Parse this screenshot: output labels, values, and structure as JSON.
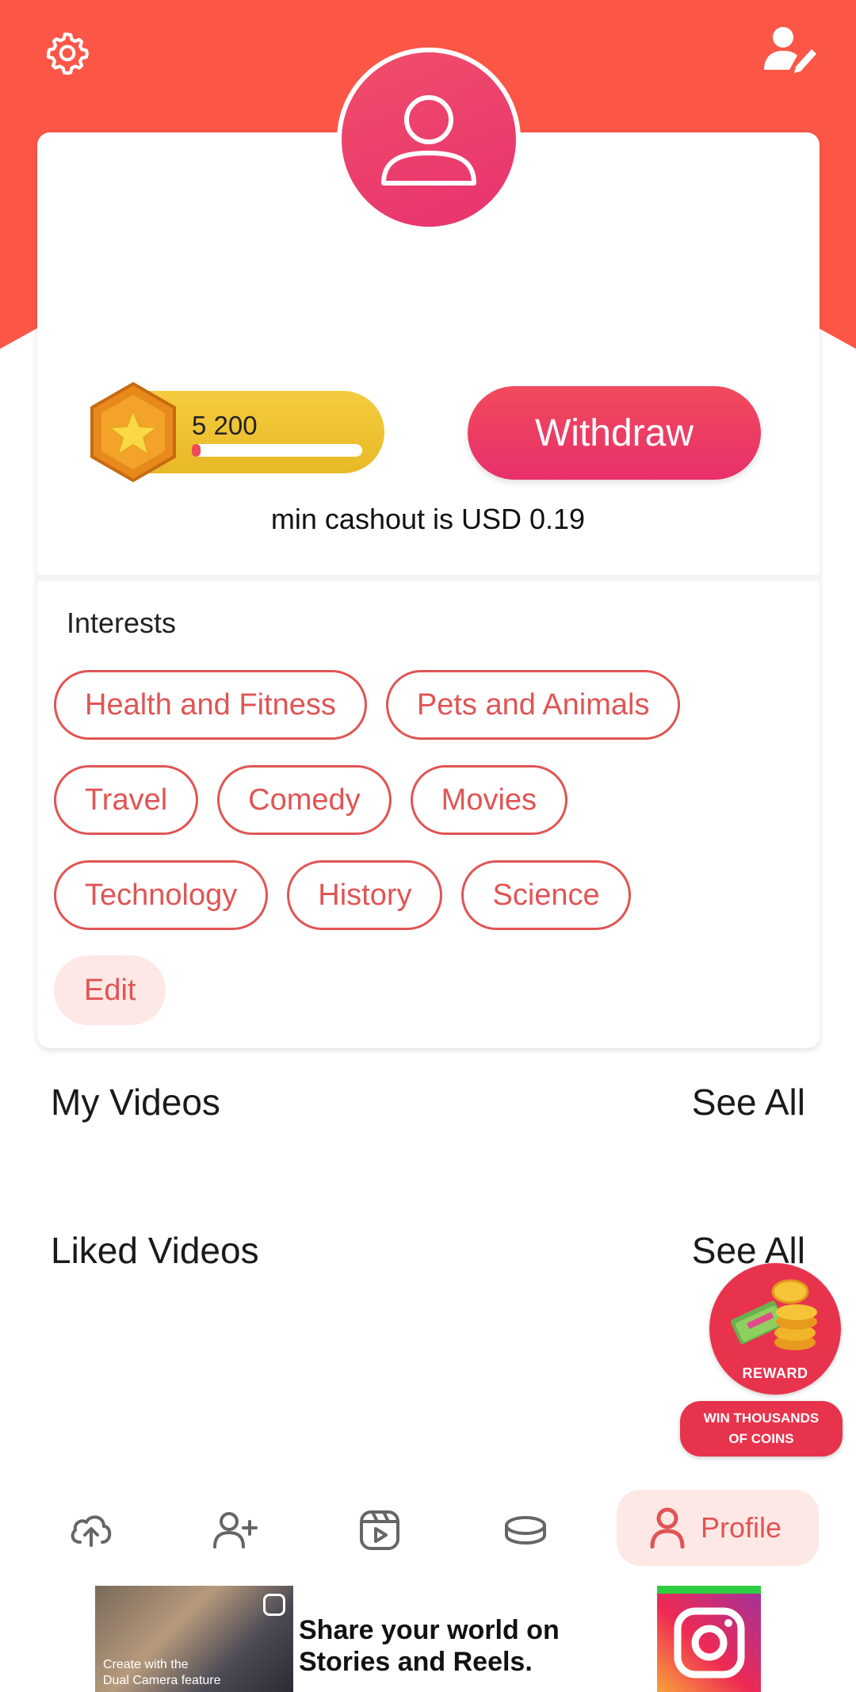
{
  "header": {
    "settings_icon": "gear-icon",
    "edit_profile_icon": "user-edit-icon"
  },
  "profile": {
    "username": "",
    "coins": "5 200",
    "coin_progress": 0.03,
    "withdraw_label": "Withdraw",
    "cashout_note": "min cashout is USD 0.19"
  },
  "interests": {
    "title": "Interests",
    "rows": [
      [
        "Health and Fitness",
        "Pets and Animals"
      ],
      [
        "Travel",
        "Comedy",
        "Movies"
      ],
      [
        "Technology",
        "History",
        "Science"
      ]
    ],
    "edit_label": "Edit"
  },
  "sections": {
    "my_videos": {
      "title": "My Videos",
      "see_all": "See All"
    },
    "liked_videos": {
      "title": "Liked Videos",
      "see_all": "See All"
    }
  },
  "reward": {
    "label": "REWARD",
    "line1": "WIN THOUSANDS",
    "line2": "OF COINS"
  },
  "nav": {
    "items": [
      "upload-icon",
      "add-friend-icon",
      "reels-icon",
      "coins-icon"
    ],
    "profile_label": "Profile"
  },
  "ad": {
    "photo_caption_1": "Create with the",
    "photo_caption_2": "Dual Camera feature",
    "headline_1": "Share your world on",
    "headline_2": "Stories and Reels."
  },
  "colors": {
    "accent": "#fc5647",
    "pink": "#e8336f",
    "chip": "#e15454",
    "gold": "#f4cc3f"
  }
}
